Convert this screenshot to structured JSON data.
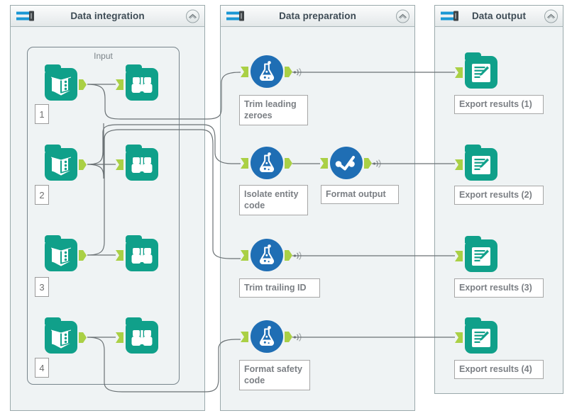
{
  "panels": [
    {
      "id": "data-integration",
      "title": "Data integration",
      "icon": "panel-bars-icon",
      "collapse_icon": "chevron-up-icon"
    },
    {
      "id": "data-preparation",
      "title": "Data preparation",
      "icon": "panel-bars-icon",
      "collapse_icon": "chevron-up-icon"
    },
    {
      "id": "data-output",
      "title": "Data output",
      "icon": "panel-bars-icon",
      "collapse_icon": "chevron-up-icon"
    }
  ],
  "group": {
    "label": "Input"
  },
  "integration_rows": [
    {
      "badge": "1",
      "reader_icon": "book-reader-icon",
      "inspect_icon": "binoculars-icon"
    },
    {
      "badge": "2",
      "reader_icon": "book-reader-icon",
      "inspect_icon": "binoculars-icon"
    },
    {
      "badge": "3",
      "reader_icon": "book-reader-icon",
      "inspect_icon": "binoculars-icon"
    },
    {
      "badge": "4",
      "reader_icon": "book-reader-icon",
      "inspect_icon": "binoculars-icon"
    }
  ],
  "preparation_nodes": [
    {
      "label": "Trim leading\nzeroes",
      "icon": "flask-icon"
    },
    {
      "label": "Isolate entity\ncode",
      "icon": "flask-icon"
    },
    {
      "label": "Format output",
      "icon": "formula-check-icon"
    },
    {
      "label": "Trim trailing ID",
      "icon": "flask-icon"
    },
    {
      "label": "Format safety\ncode",
      "icon": "flask-icon"
    }
  ],
  "output_nodes": [
    {
      "label": "Export results (1)",
      "icon": "export-document-icon"
    },
    {
      "label": "Export results (2)",
      "icon": "export-document-icon"
    },
    {
      "label": "Export results (3)",
      "icon": "export-document-icon"
    },
    {
      "label": "Export results (4)",
      "icon": "export-document-icon"
    }
  ],
  "colors": {
    "teal": "#10a08a",
    "blue": "#1f6eb4",
    "port_green": "#aad045",
    "panel_bg": "#eff3f4",
    "panel_border": "#9aa9ab",
    "header_icon_blue": "#1a97d4",
    "label_text": "#7b7f84",
    "wire": "#6b7275"
  }
}
